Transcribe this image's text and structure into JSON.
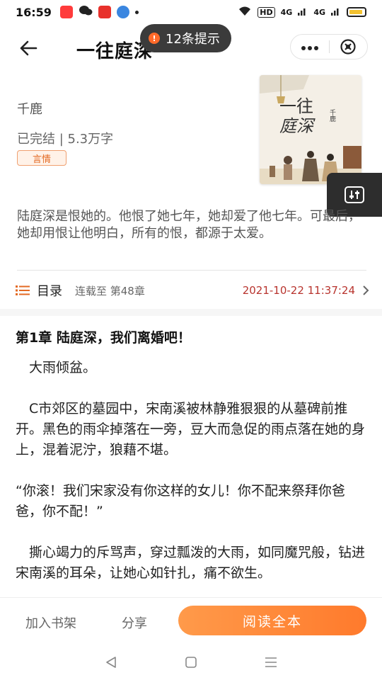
{
  "status_bar": {
    "time": "16:59",
    "network_label": "HD",
    "signal_1": "4G",
    "signal_2": "4G"
  },
  "header": {
    "back_icon": "arrow-left-icon",
    "title": "一往庭深",
    "more_icon": "more-dots-icon",
    "close_icon": "close-circle-icon"
  },
  "toast": {
    "icon_text": "!",
    "text": "12条提示"
  },
  "book": {
    "author": "千鹿",
    "status": "已完结 | 5.3万字",
    "genre": "言情",
    "cover": {
      "title_line1": "一往",
      "title_line2": "庭深",
      "author": "千鹿"
    },
    "synopsis": "陆庭深是恨她的。他恨了她七年，她却爱了他七年。可最后，她却用恨让他明白，所有的恨，都源于太爱。"
  },
  "toc": {
    "icon": "list-icon",
    "label": "目录",
    "serial": "连载至 第48章",
    "updated": "2021-10-22 11:37:24",
    "chevron_icon": "chevron-right-icon"
  },
  "chapter": {
    "title": "第1章 陆庭深，我们离婚吧！",
    "paragraphs": [
      "大雨倾盆。",
      "C市郊区的墓园中，宋南溪被林静雅狠狠的从墓碑前推开。黑色的雨伞掉落在一旁，豆大而急促的雨点落在她的身上，混着泥泞，狼藉不堪。",
      "“你滚！我们宋家没有你这样的女儿！你不配来祭拜你爸爸，你不配！”",
      "撕心竭力的斥骂声，穿过瓢泼的大雨，如同魔咒般，钻进宋南溪的耳朵，让她心如针扎，痛不欲生。"
    ]
  },
  "bottom_bar": {
    "add_shelf": "加入书架",
    "share": "分享",
    "read_all": "阅读全本"
  },
  "float_button": {
    "icon": "adjust-sliders-icon"
  },
  "nav_bar": {
    "back_icon": "triangle-back-icon",
    "home_icon": "square-home-icon",
    "menu_icon": "three-lines-menu-icon"
  },
  "colors": {
    "accent_orange": "#ff7a2c",
    "timestamp_red": "#b8342e",
    "tag_orange": "#e36a23",
    "toast_bg": "#3b3b3b"
  }
}
